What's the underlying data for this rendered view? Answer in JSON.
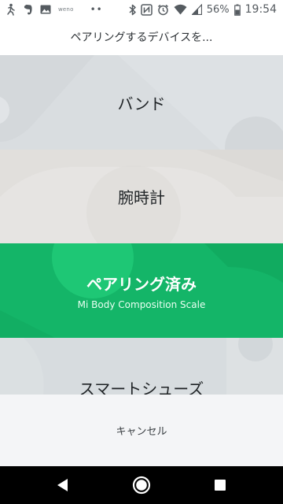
{
  "status_bar": {
    "left_icons": [
      "activity-notification-icon",
      "evernote-icon",
      "gallery-icon"
    ],
    "weno_label": "weno",
    "more_dots": "••",
    "right_icons": [
      "bluetooth-icon",
      "nfc-icon",
      "alarm-icon",
      "wifi-icon",
      "signal-icon",
      "battery-icon"
    ],
    "battery": "56%",
    "time": "19:54"
  },
  "dialog": {
    "title": "ペアリングするデバイスを..."
  },
  "options": {
    "band": {
      "label": "バンド"
    },
    "watch": {
      "label": "腕時計"
    },
    "paired": {
      "label": "ペアリング済み",
      "sublabel": "Mi Body Composition Scale"
    },
    "shoes": {
      "label": "スマートシューズ"
    }
  },
  "cancel": {
    "label": "キャンセル"
  },
  "nav_bar": {
    "buttons": [
      "back-icon",
      "home-icon",
      "recents-icon"
    ]
  },
  "colors": {
    "paired_green": "#14b568",
    "band_bg": "#d9dde0",
    "watch_bg": "#e1dfdc",
    "shoes_bg": "#d7dcdf"
  }
}
